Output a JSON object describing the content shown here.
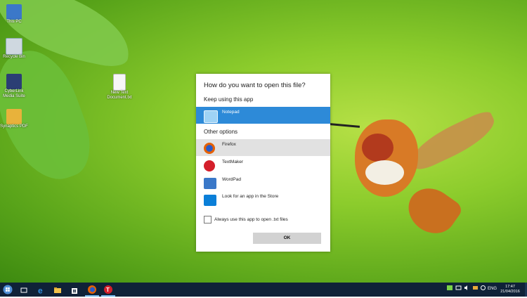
{
  "desktop": {
    "icons": [
      {
        "label": "This PC"
      },
      {
        "label": "Recycle Bin"
      },
      {
        "label": "CyberLink Media Suite"
      },
      {
        "label": "Synaptics PDF"
      },
      {
        "label": "New Text Document.txt"
      }
    ]
  },
  "dialog": {
    "title": "How do you want to open this file?",
    "keep_using_label": "Keep using this app",
    "current_app": {
      "label": "Notepad",
      "icon": "notepad-icon"
    },
    "other_options_label": "Other options",
    "options": [
      {
        "label": "Firefox",
        "icon": "firefox-icon"
      },
      {
        "label": "TextMaker",
        "icon": "textmaker-icon"
      },
      {
        "label": "WordPad",
        "icon": "wordpad-icon"
      },
      {
        "label": "Look for an app in the Store",
        "icon": "store-icon"
      }
    ],
    "checkbox_label": "Always use this app to open .txt files",
    "checkbox_checked": false,
    "ok_label": "OK"
  },
  "taskbar": {
    "language": "ENG",
    "time": "17:47",
    "date": "21/04/2016"
  },
  "colors": {
    "accent": "#2d8ad8",
    "taskbar": "#0f2238"
  }
}
